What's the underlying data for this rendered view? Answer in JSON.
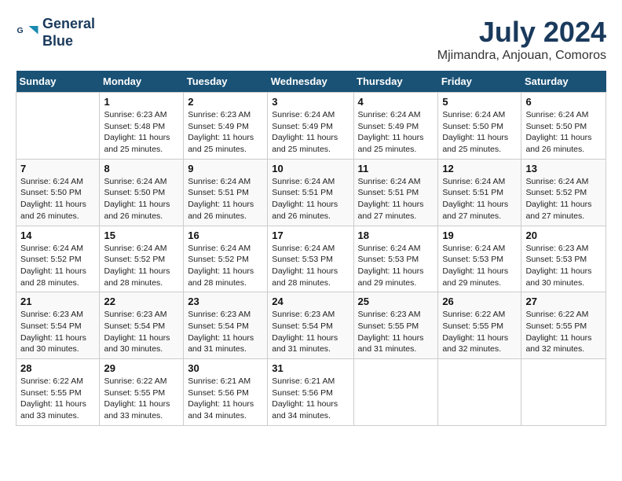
{
  "logo": {
    "line1": "General",
    "line2": "Blue"
  },
  "title": "July 2024",
  "location": "Mjimandra, Anjouan, Comoros",
  "weekdays": [
    "Sunday",
    "Monday",
    "Tuesday",
    "Wednesday",
    "Thursday",
    "Friday",
    "Saturday"
  ],
  "weeks": [
    [
      {
        "day": "",
        "info": ""
      },
      {
        "day": "1",
        "info": "Sunrise: 6:23 AM\nSunset: 5:48 PM\nDaylight: 11 hours\nand 25 minutes."
      },
      {
        "day": "2",
        "info": "Sunrise: 6:23 AM\nSunset: 5:49 PM\nDaylight: 11 hours\nand 25 minutes."
      },
      {
        "day": "3",
        "info": "Sunrise: 6:24 AM\nSunset: 5:49 PM\nDaylight: 11 hours\nand 25 minutes."
      },
      {
        "day": "4",
        "info": "Sunrise: 6:24 AM\nSunset: 5:49 PM\nDaylight: 11 hours\nand 25 minutes."
      },
      {
        "day": "5",
        "info": "Sunrise: 6:24 AM\nSunset: 5:50 PM\nDaylight: 11 hours\nand 25 minutes."
      },
      {
        "day": "6",
        "info": "Sunrise: 6:24 AM\nSunset: 5:50 PM\nDaylight: 11 hours\nand 26 minutes."
      }
    ],
    [
      {
        "day": "7",
        "info": "Sunrise: 6:24 AM\nSunset: 5:50 PM\nDaylight: 11 hours\nand 26 minutes."
      },
      {
        "day": "8",
        "info": "Sunrise: 6:24 AM\nSunset: 5:50 PM\nDaylight: 11 hours\nand 26 minutes."
      },
      {
        "day": "9",
        "info": "Sunrise: 6:24 AM\nSunset: 5:51 PM\nDaylight: 11 hours\nand 26 minutes."
      },
      {
        "day": "10",
        "info": "Sunrise: 6:24 AM\nSunset: 5:51 PM\nDaylight: 11 hours\nand 26 minutes."
      },
      {
        "day": "11",
        "info": "Sunrise: 6:24 AM\nSunset: 5:51 PM\nDaylight: 11 hours\nand 27 minutes."
      },
      {
        "day": "12",
        "info": "Sunrise: 6:24 AM\nSunset: 5:51 PM\nDaylight: 11 hours\nand 27 minutes."
      },
      {
        "day": "13",
        "info": "Sunrise: 6:24 AM\nSunset: 5:52 PM\nDaylight: 11 hours\nand 27 minutes."
      }
    ],
    [
      {
        "day": "14",
        "info": "Sunrise: 6:24 AM\nSunset: 5:52 PM\nDaylight: 11 hours\nand 28 minutes."
      },
      {
        "day": "15",
        "info": "Sunrise: 6:24 AM\nSunset: 5:52 PM\nDaylight: 11 hours\nand 28 minutes."
      },
      {
        "day": "16",
        "info": "Sunrise: 6:24 AM\nSunset: 5:52 PM\nDaylight: 11 hours\nand 28 minutes."
      },
      {
        "day": "17",
        "info": "Sunrise: 6:24 AM\nSunset: 5:53 PM\nDaylight: 11 hours\nand 28 minutes."
      },
      {
        "day": "18",
        "info": "Sunrise: 6:24 AM\nSunset: 5:53 PM\nDaylight: 11 hours\nand 29 minutes."
      },
      {
        "day": "19",
        "info": "Sunrise: 6:24 AM\nSunset: 5:53 PM\nDaylight: 11 hours\nand 29 minutes."
      },
      {
        "day": "20",
        "info": "Sunrise: 6:23 AM\nSunset: 5:53 PM\nDaylight: 11 hours\nand 30 minutes."
      }
    ],
    [
      {
        "day": "21",
        "info": "Sunrise: 6:23 AM\nSunset: 5:54 PM\nDaylight: 11 hours\nand 30 minutes."
      },
      {
        "day": "22",
        "info": "Sunrise: 6:23 AM\nSunset: 5:54 PM\nDaylight: 11 hours\nand 30 minutes."
      },
      {
        "day": "23",
        "info": "Sunrise: 6:23 AM\nSunset: 5:54 PM\nDaylight: 11 hours\nand 31 minutes."
      },
      {
        "day": "24",
        "info": "Sunrise: 6:23 AM\nSunset: 5:54 PM\nDaylight: 11 hours\nand 31 minutes."
      },
      {
        "day": "25",
        "info": "Sunrise: 6:23 AM\nSunset: 5:55 PM\nDaylight: 11 hours\nand 31 minutes."
      },
      {
        "day": "26",
        "info": "Sunrise: 6:22 AM\nSunset: 5:55 PM\nDaylight: 11 hours\nand 32 minutes."
      },
      {
        "day": "27",
        "info": "Sunrise: 6:22 AM\nSunset: 5:55 PM\nDaylight: 11 hours\nand 32 minutes."
      }
    ],
    [
      {
        "day": "28",
        "info": "Sunrise: 6:22 AM\nSunset: 5:55 PM\nDaylight: 11 hours\nand 33 minutes."
      },
      {
        "day": "29",
        "info": "Sunrise: 6:22 AM\nSunset: 5:55 PM\nDaylight: 11 hours\nand 33 minutes."
      },
      {
        "day": "30",
        "info": "Sunrise: 6:21 AM\nSunset: 5:56 PM\nDaylight: 11 hours\nand 34 minutes."
      },
      {
        "day": "31",
        "info": "Sunrise: 6:21 AM\nSunset: 5:56 PM\nDaylight: 11 hours\nand 34 minutes."
      },
      {
        "day": "",
        "info": ""
      },
      {
        "day": "",
        "info": ""
      },
      {
        "day": "",
        "info": ""
      }
    ]
  ]
}
